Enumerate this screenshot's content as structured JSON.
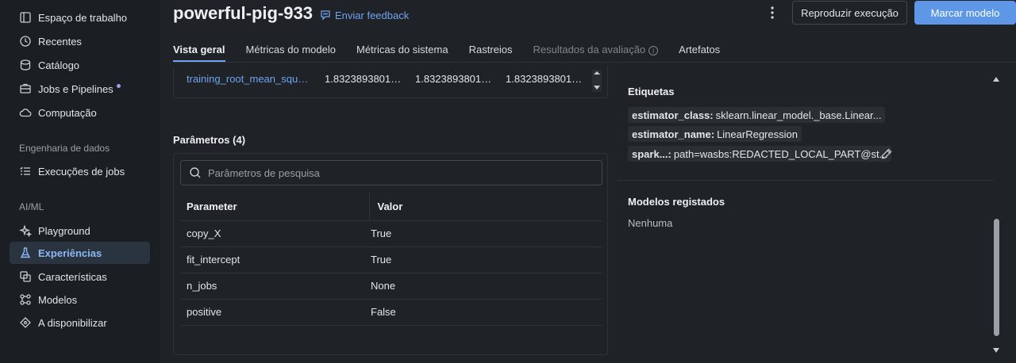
{
  "sidebar": {
    "items_top": [
      {
        "label": "Espaço de trabalho",
        "icon": "workspace-icon"
      },
      {
        "label": "Recentes",
        "icon": "clock-icon"
      },
      {
        "label": "Catálogo",
        "icon": "catalog-icon"
      },
      {
        "label": "Jobs e Pipelines",
        "icon": "jobs-icon"
      },
      {
        "label": "Computação",
        "icon": "cloud-icon"
      }
    ],
    "section_data_eng": "Engenharia de dados",
    "job_runs": "Execuções de jobs",
    "section_aiml": "AI/ML",
    "items_aiml": [
      {
        "label": "Playground",
        "icon": "sparkle-icon"
      },
      {
        "label": "Experiências",
        "icon": "flask-icon"
      },
      {
        "label": "Características",
        "icon": "features-icon"
      },
      {
        "label": "Modelos",
        "icon": "models-icon"
      },
      {
        "label": "A disponibilizar",
        "icon": "serving-icon"
      }
    ]
  },
  "header": {
    "title": "powerful-pig-933",
    "feedback": "Enviar feedback",
    "reproduce_button": "Reproduzir execução",
    "register_button": "Marcar modelo"
  },
  "tabs": [
    {
      "label": "Vista geral"
    },
    {
      "label": "Métricas do modelo"
    },
    {
      "label": "Métricas do sistema"
    },
    {
      "label": "Rastreios"
    },
    {
      "label": "Resultados da avaliação"
    },
    {
      "label": "Artefatos"
    }
  ],
  "metric_row": {
    "name": "training_root_mean_squa...",
    "values": [
      "1.83238938015...",
      "1.83238938015...",
      "1.83238938015..."
    ]
  },
  "params": {
    "title": "Parâmetros (4)",
    "search_placeholder": "Parâmetros de pesquisa",
    "columns": [
      "Parameter",
      "Valor"
    ],
    "rows": [
      [
        "copy_X",
        "True"
      ],
      [
        "fit_intercept",
        "True"
      ],
      [
        "n_jobs",
        "None"
      ],
      [
        "positive",
        "False"
      ]
    ]
  },
  "tags": {
    "title": "Etiquetas",
    "items": [
      {
        "key": "estimator_class",
        "value": "sklearn.linear_model._base.Linear..."
      },
      {
        "key": "estimator_name",
        "value": "LinearRegression"
      },
      {
        "key": "spark...",
        "value": "path=wasbs:REDACTED_LOCAL_PART@st..."
      }
    ]
  },
  "registered_models": {
    "title": "Modelos registados",
    "value": "Nenhuma"
  },
  "colors": {
    "accent": "#5d97e6",
    "link": "#6fa3ee",
    "background": "#1f2327"
  }
}
